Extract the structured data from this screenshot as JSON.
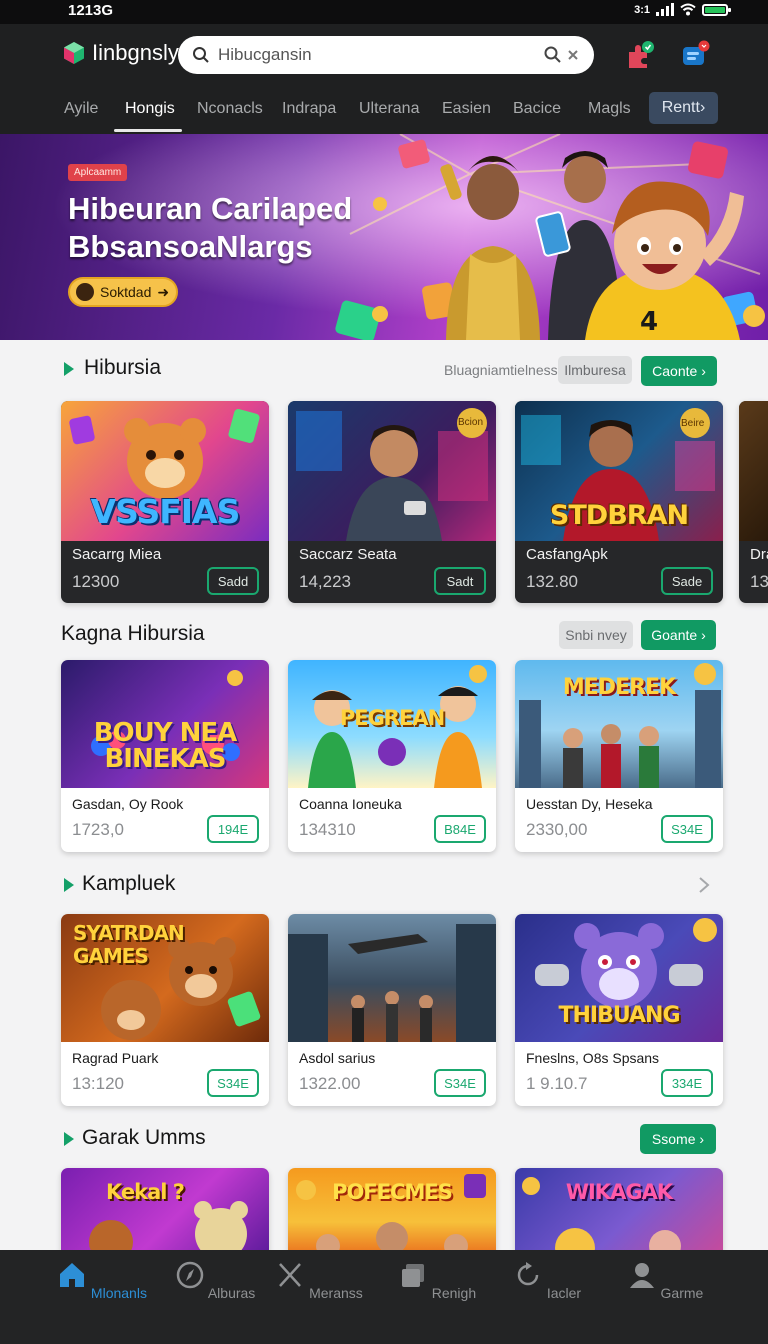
{
  "status_bar": {
    "time": "1213G",
    "network": "3:1"
  },
  "header": {
    "brand": "Iinbgnsly",
    "search_placeholder": "Hibucgansin"
  },
  "nav": {
    "tabs": [
      "Ayile",
      "Hongis",
      "Nconacls",
      "Indrapa",
      "Ulterana",
      "Easien",
      "Bacice",
      "Magls"
    ],
    "active_index": 1,
    "pill": "Rentt"
  },
  "hero": {
    "badge": "Aplcaamm",
    "title_line1": "Hibeuran Carilaped",
    "title_line2": "BbsansoaNlargs",
    "cta": "Soktdad"
  },
  "sections": [
    {
      "title": "Hibursia",
      "link": "Bluagniamtielness",
      "tag": "Ilmburesa",
      "button": "Caonte",
      "cards": [
        {
          "art": "VSSFIAS",
          "name": "Sacarrg Miea",
          "value": "12300",
          "button": "Sadd"
        },
        {
          "art": "",
          "name": "Saccarz Seata",
          "value": "14,223",
          "button": "Sadt",
          "corner": "Bcion"
        },
        {
          "art": "STDBRAN",
          "name": "CasfangApk",
          "value": "132.80",
          "button": "Sade",
          "corner": "Beire"
        },
        {
          "art": "",
          "name": "Dra",
          "value": "13",
          "button": ""
        }
      ]
    },
    {
      "title": "Kagna Hibursia",
      "tag": "Snbi nvey",
      "button": "Goante",
      "cards": [
        {
          "art": "BOUY NEA BINEKAS",
          "name": "Gasdan, Oy Rook",
          "value": "1723,0",
          "button": "194E"
        },
        {
          "art": "PEGREAN",
          "name": "Coanna Ioneuka",
          "value": "134310",
          "button": "B84E"
        },
        {
          "art": "MEDEREK",
          "name": "Uesstan Dy, Heseka",
          "value": "2330,00",
          "button": "S34E"
        }
      ]
    },
    {
      "title": "Kampluek",
      "cards": [
        {
          "art": "SYATRDAN GAMES",
          "name": "Ragrad Puark",
          "value": "13:120",
          "button": "S34E"
        },
        {
          "art": "",
          "name": "Asdol sarius",
          "value": "1322.00",
          "button": "S34E"
        },
        {
          "art": "THIBUANG",
          "name": "Fneslns, O8s Spsans",
          "value": "1 9.10.7",
          "button": "334E"
        }
      ]
    },
    {
      "title": "Garak Umms",
      "button": "Ssome",
      "cards": [
        {
          "art": "Kekal ?",
          "name": "",
          "value": "",
          "button": ""
        },
        {
          "art": "POFECMES",
          "name": "",
          "value": "",
          "button": ""
        },
        {
          "art": "WIKAGAK",
          "name": "",
          "value": "",
          "button": ""
        }
      ]
    }
  ],
  "bottom_nav": [
    {
      "label": "Mlonanls",
      "icon": "home-icon"
    },
    {
      "label": "Alburas",
      "icon": "compass-icon"
    },
    {
      "label": "Meranss",
      "icon": "cross-tools-icon"
    },
    {
      "label": "Renigh",
      "icon": "cards-icon"
    },
    {
      "label": "Iacler",
      "icon": "refresh-icon"
    },
    {
      "label": "Garme",
      "icon": "profile-icon"
    }
  ],
  "colors": {
    "accent": "#119a63",
    "active_nav": "#2d8fd6",
    "header_bg": "#1f2021"
  }
}
